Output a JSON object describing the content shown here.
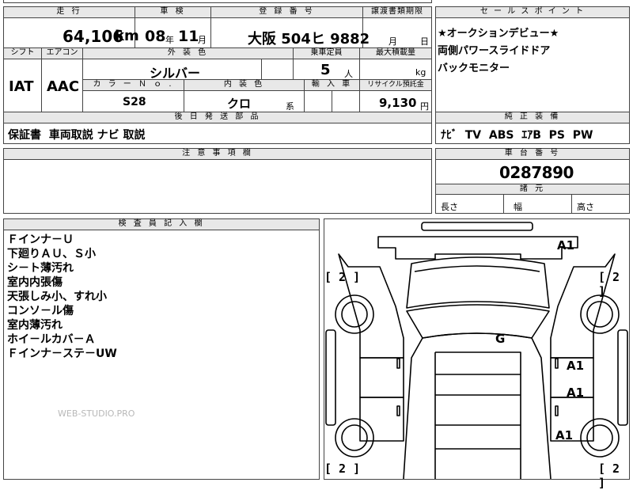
{
  "top_partial": {
    "left": "",
    "mid": "",
    "right": ""
  },
  "header": {
    "mileage_label": "走 行",
    "inspection_label": "車 検",
    "plate_label": "登 録 番 号",
    "transfer_label": "譲渡書類期限",
    "sell_label": "セ ー ル ス ポ イ ン ト"
  },
  "values": {
    "mileage": "64,106",
    "mileage_unit": "km",
    "insp_year": "08",
    "insp_year_unit": "年",
    "insp_month": "11",
    "insp_month_unit": "月",
    "plate": "大阪 504ヒ 9882",
    "transfer_month": "月",
    "transfer_day": "日"
  },
  "sell_points": [
    "★オークションデビュー★",
    "両側パワースライドドア",
    "バックモニター"
  ],
  "row2": {
    "shift_label": "シフト",
    "ac_label": "エアコン",
    "ext_color_label": "外 装 色",
    "capacity_label": "乗車定員",
    "max_load_label": "最大積載量",
    "shift": "IAT",
    "ac": "AAC",
    "ext_color": "シルバー",
    "capacity": "5",
    "capacity_unit": "人",
    "max_load_unit": "kg",
    "color_no_label": "カ ラ ー Ｎ ｏ .",
    "int_color_label": "内 装 色",
    "import_label": "輸 入 車",
    "recycle_label": "リサイクル預託金",
    "color_no": "S28",
    "int_color": "クロ",
    "int_color_unit": "系",
    "recycle": "9,130",
    "recycle_unit": "円"
  },
  "later_parts": {
    "label": "後 日 発 送 部 品",
    "value": "保証書  車両取説 ナビ 取説"
  },
  "standard_equipment": {
    "label": "純 正 装 備",
    "value": "ﾅﾋﾞ  TV  ABS  ｴｱB  PS  PW"
  },
  "notice": {
    "label": "注 意 事 項 欄"
  },
  "chassis": {
    "label": "車 台 番 号",
    "value": "0287890",
    "dims_label": "諸 元",
    "length": "長さ",
    "width": "幅",
    "height": "高さ"
  },
  "inspector": {
    "label": "検 査 員 記 入 欄",
    "lines": [
      "Ｆインナ－Ｕ",
      "下廻りＡＵ、Ｓ小",
      "シ－ト薄汚れ",
      "室内内張傷",
      "天張しみ小、すれ小",
      "コンソ－ル傷",
      "室内薄汚れ",
      "ホイ－ルカバ－Ａ",
      "Ｆインナ－ステ－UW"
    ]
  },
  "watermark": "WEB-STUDIO.PRO",
  "damage": {
    "a1_top": "A1",
    "g": "G",
    "a1_mid1": "A1",
    "a1_mid2": "A1",
    "a1_bottom": "A1",
    "bracket_tl": "[ 2 ]",
    "bracket_tr": "[ 2 ]",
    "bracket_bl": "[ 2 ]",
    "bracket_br": "[ 2 ]"
  }
}
